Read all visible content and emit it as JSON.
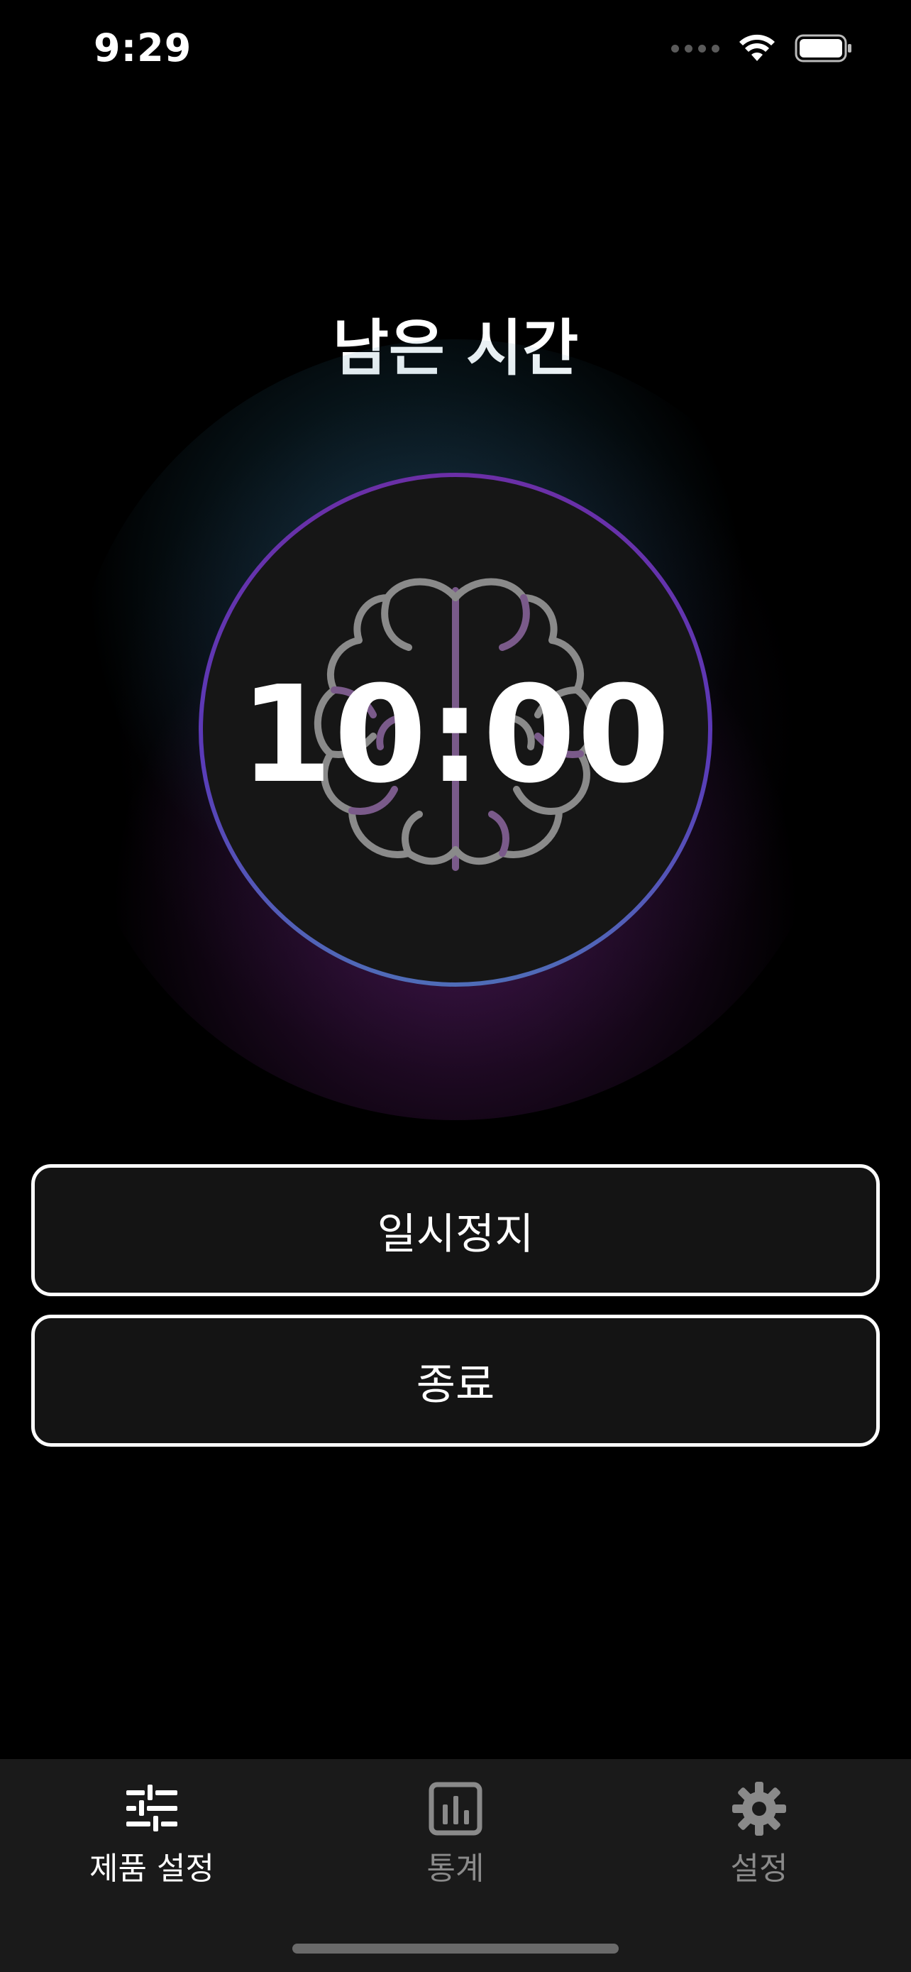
{
  "status_bar": {
    "time": "9:29",
    "icons": [
      "signal-dots-icon",
      "wifi-icon",
      "battery-icon"
    ]
  },
  "main": {
    "title": "남은 시간",
    "timer": "10:00",
    "center_icon": "brain-icon"
  },
  "buttons": {
    "pause_label": "일시정지",
    "stop_label": "종료"
  },
  "tab_bar": {
    "tabs": [
      {
        "label": "제품 설정",
        "icon": "sliders-icon",
        "active": true
      },
      {
        "label": "통계",
        "icon": "bar-chart-icon",
        "active": false
      },
      {
        "label": "설정",
        "icon": "gear-icon",
        "active": false
      }
    ]
  },
  "colors": {
    "background": "#000000",
    "ring_top": "#6b2fa6",
    "ring_bottom": "#4f6db8",
    "tab_active": "#ffffff",
    "tab_inactive": "#8a8a8a"
  }
}
